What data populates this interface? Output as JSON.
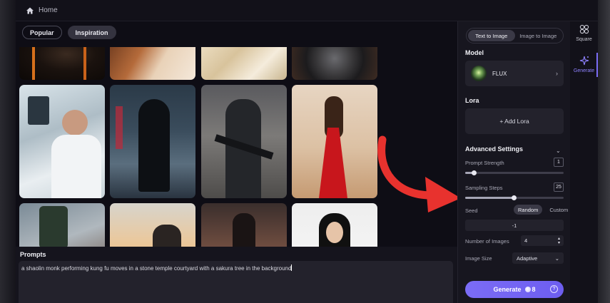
{
  "topbar": {
    "breadcrumb": "Home"
  },
  "tabs": [
    {
      "label": "Popular",
      "active": false
    },
    {
      "label": "Inspiration",
      "active": true
    }
  ],
  "prompts": {
    "title": "Prompts",
    "value": "a shaolin monk performing kung fu moves in a stone temple courtyard with a sakura tree in the background"
  },
  "panel": {
    "modes": [
      {
        "label": "Text to Image",
        "active": true
      },
      {
        "label": "Image to Image",
        "active": false
      }
    ],
    "model_title": "Model",
    "model_name": "FLUX",
    "lora_title": "Lora",
    "add_lora": "+ Add Lora",
    "advanced_title": "Advanced Settings",
    "prompt_strength": {
      "label": "Prompt Strength",
      "value": "1",
      "fraction": 0.09
    },
    "sampling_steps": {
      "label": "Sampling Steps",
      "value": "25",
      "fraction": 0.49
    },
    "seed": {
      "label": "Seed",
      "options": [
        "Random",
        "Custom"
      ],
      "selected": "Random",
      "value": "-1"
    },
    "num_images": {
      "label": "Number of Images",
      "value": "4"
    },
    "image_size": {
      "label": "Image Size",
      "value": "Adaptive"
    },
    "generate": {
      "label": "Generate",
      "cost": "8"
    }
  },
  "nav": [
    {
      "label": "Square",
      "icon": "square-grid-icon",
      "active": false
    },
    {
      "label": "Generate",
      "icon": "sparkle-generate-icon",
      "active": true
    }
  ],
  "colors": {
    "accent": "#7b6cf6",
    "arrow": "#e8322e",
    "panel": "#17161f"
  }
}
